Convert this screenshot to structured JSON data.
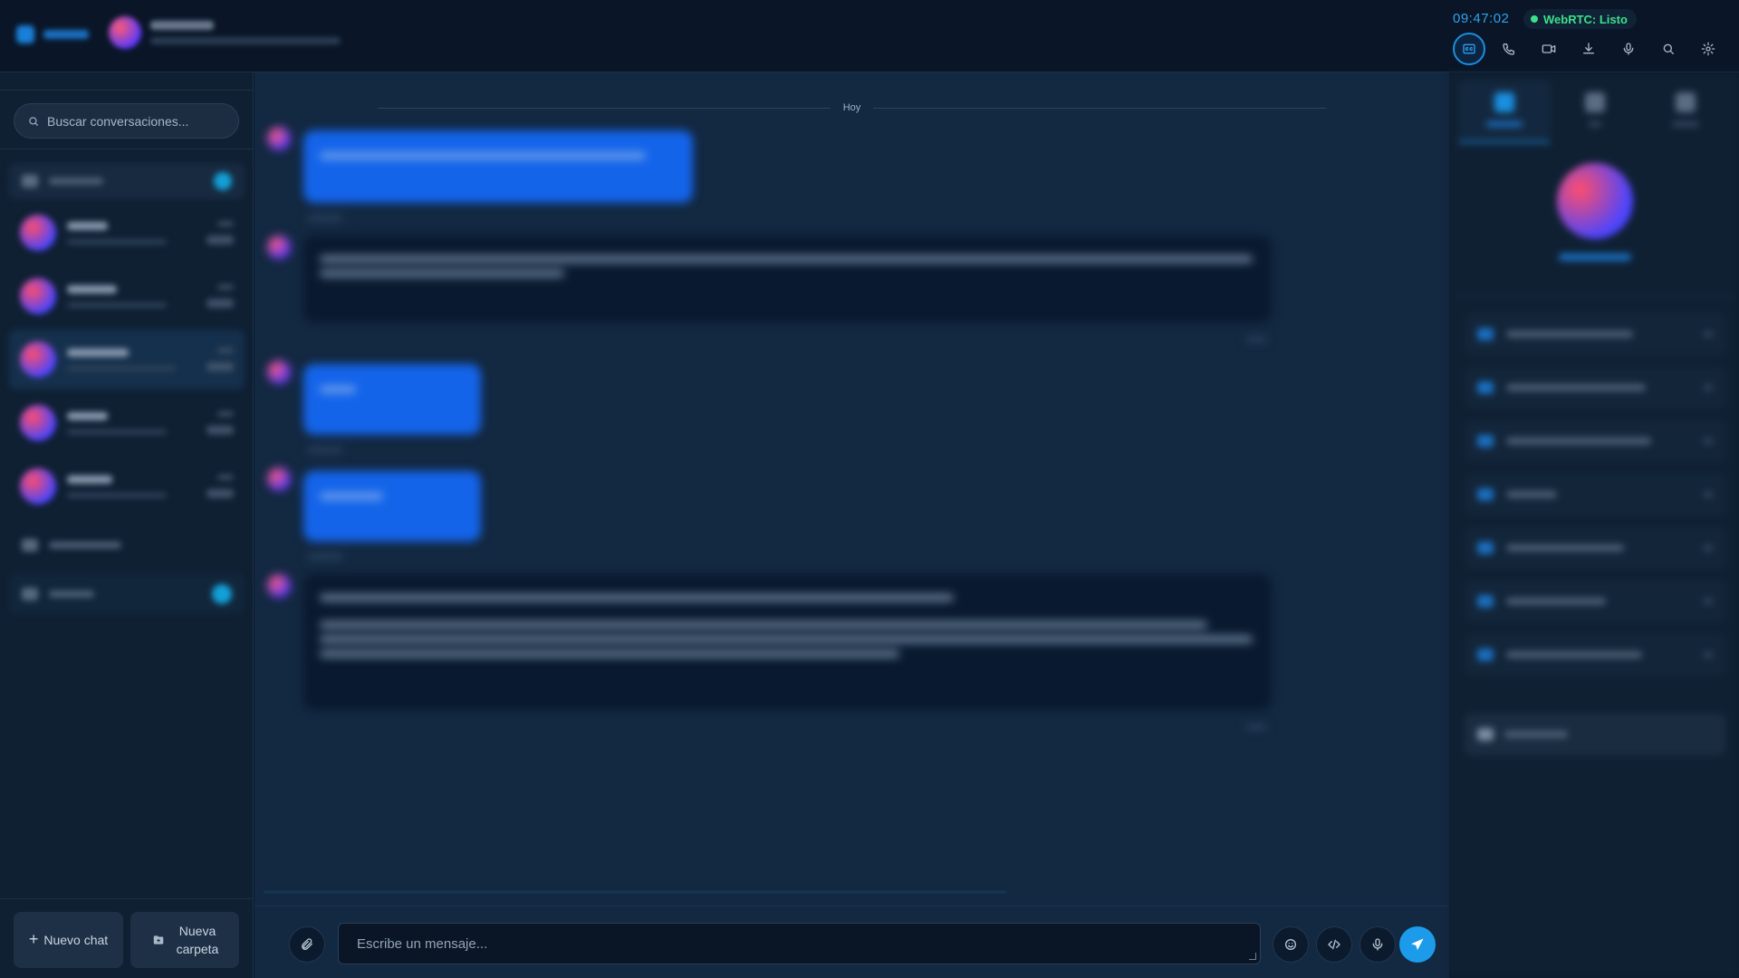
{
  "topbar": {
    "clock": "09:47:02",
    "webrtc_status": "WebRTC: Listo",
    "webrtc_color": "#3ee08a",
    "icons": [
      "captions-icon",
      "phone-icon",
      "video-icon",
      "download-icon",
      "microphone-icon",
      "search-icon",
      "gear-icon"
    ]
  },
  "sidebar": {
    "search_placeholder": "Buscar conversaciones...",
    "new_chat_label": "Nuevo chat",
    "new_folder_label": "Nueva carpeta"
  },
  "chat": {
    "day_separator": "Hoy",
    "input_placeholder": "Escribe un mensaje...",
    "accent_color": "#1c9bea",
    "user_bubble_color": "#1464ea"
  }
}
